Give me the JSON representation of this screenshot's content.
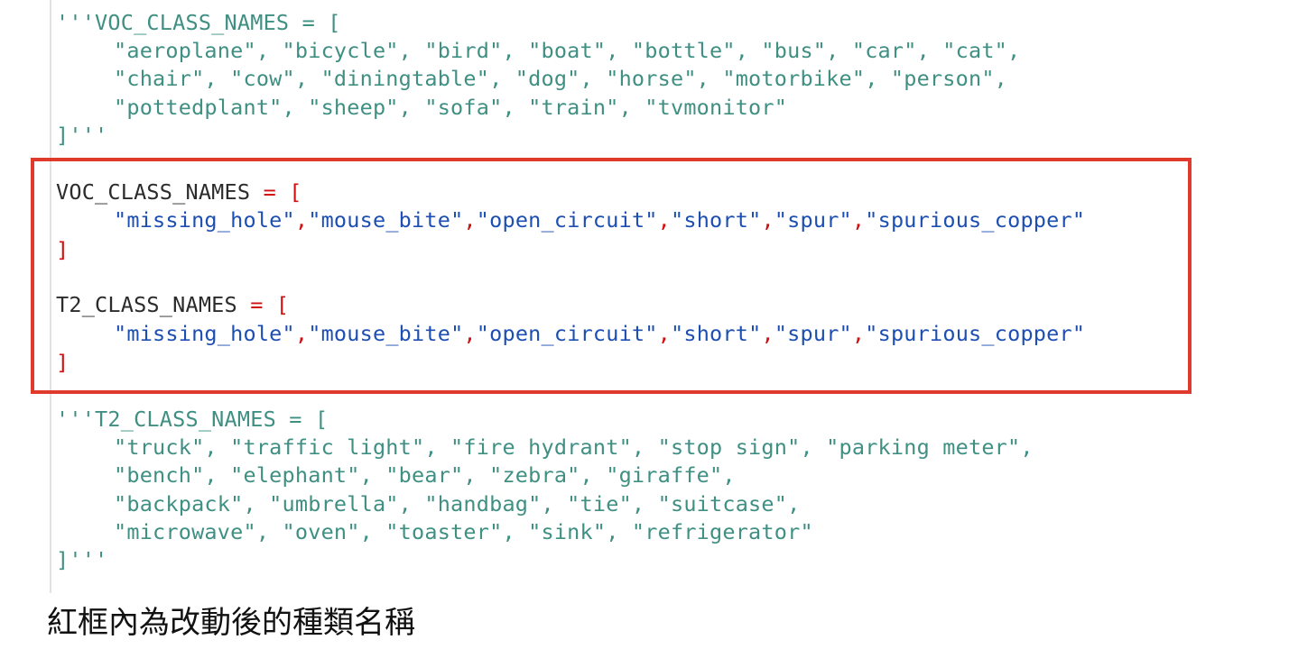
{
  "colors": {
    "comment": "#3f8f83",
    "identifier": "#2b2b2b",
    "operator": "#d01010",
    "string": "#1d4fb3",
    "highlight_box": "#e03a2d"
  },
  "code": {
    "comment_top": {
      "l1": "'''VOC_CLASS_NAMES = [",
      "l2": "\"aeroplane\", \"bicycle\", \"bird\", \"boat\", \"bottle\", \"bus\", \"car\", \"cat\",",
      "l3": "\"chair\", \"cow\", \"diningtable\", \"dog\", \"horse\", \"motorbike\", \"person\",",
      "l4": "\"pottedplant\", \"sheep\", \"sofa\", \"train\", \"tvmonitor\"",
      "l5": "]'''"
    },
    "voc": {
      "name": "VOC_CLASS_NAMES",
      "eq": " = ",
      "open": "[",
      "close": "]",
      "items": [
        "\"missing_hole\"",
        "\"mouse_bite\"",
        "\"open_circuit\"",
        "\"short\"",
        "\"spur\"",
        "\"spurious_copper\""
      ],
      "sep": ","
    },
    "t2": {
      "name": "T2_CLASS_NAMES",
      "eq": " = ",
      "open": "[",
      "close": "]",
      "items": [
        "\"missing_hole\"",
        "\"mouse_bite\"",
        "\"open_circuit\"",
        "\"short\"",
        "\"spur\"",
        "\"spurious_copper\""
      ],
      "sep": ","
    },
    "comment_bottom": {
      "l1": "'''T2_CLASS_NAMES = [",
      "l2": "\"truck\", \"traffic light\", \"fire hydrant\", \"stop sign\", \"parking meter\",",
      "l3": "\"bench\", \"elephant\", \"bear\", \"zebra\", \"giraffe\",",
      "l4": "\"backpack\", \"umbrella\", \"handbag\", \"tie\", \"suitcase\",",
      "l5": "\"microwave\", \"oven\", \"toaster\", \"sink\", \"refrigerator\"",
      "l6": "]'''"
    }
  },
  "caption": "紅框內為改動後的種類名稱"
}
